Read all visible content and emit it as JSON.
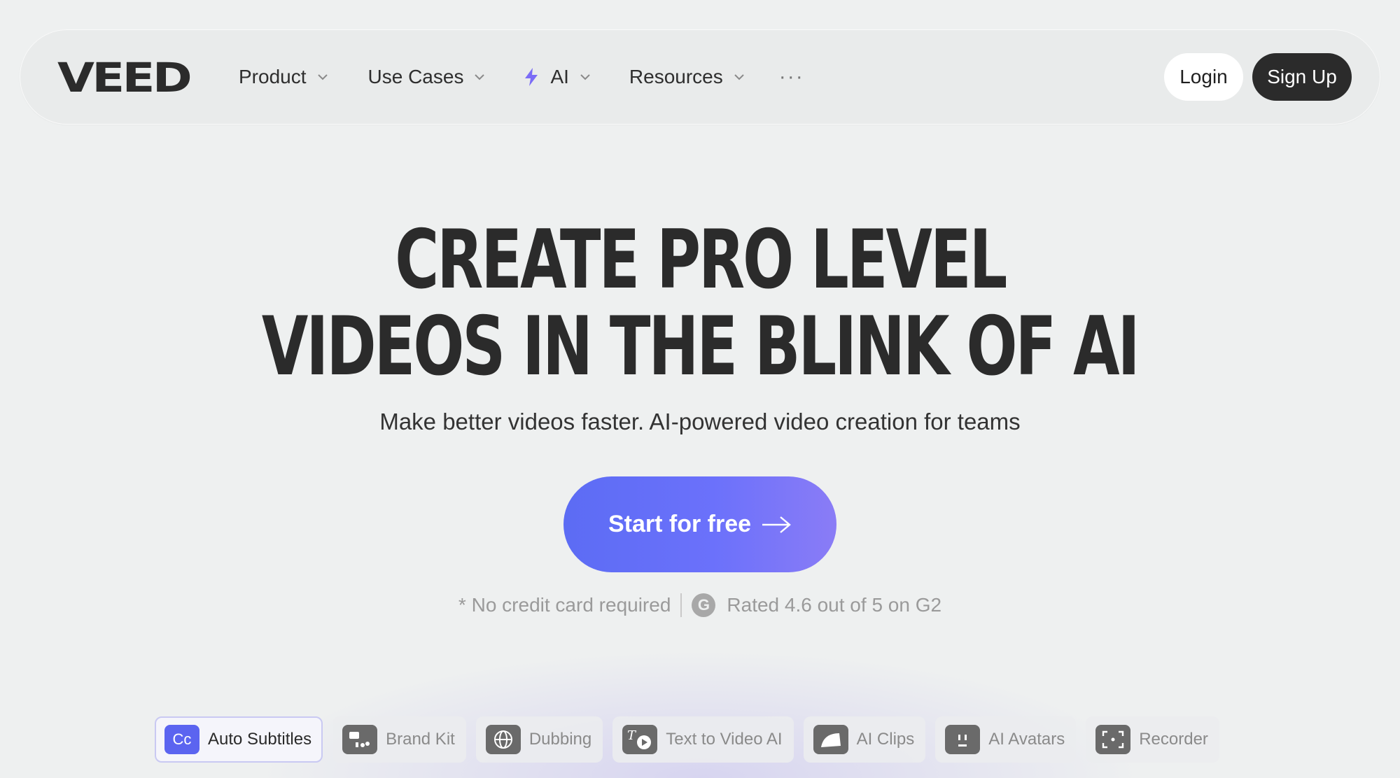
{
  "nav": {
    "logo": "VEED",
    "items": [
      {
        "label": "Product"
      },
      {
        "label": "Use Cases"
      },
      {
        "label": "AI"
      },
      {
        "label": "Resources"
      }
    ],
    "more": "···",
    "login": "Login",
    "signup": "Sign Up"
  },
  "hero": {
    "line1": "CREATE PRO LEVEL",
    "line2": "VIDEOS IN THE BLINK OF AI",
    "subtitle": "Make better videos faster. AI-powered video creation for teams",
    "cta": "Start for free",
    "note": "* No credit card required",
    "rating": "Rated 4.6 out of 5 on G2",
    "g2_badge": "G"
  },
  "tabs": [
    {
      "label": "Auto Subtitles",
      "icon": "cc-icon",
      "icon_text": "Cc",
      "active": true
    },
    {
      "label": "Brand Kit",
      "icon": "brand-kit-icon"
    },
    {
      "label": "Dubbing",
      "icon": "globe-icon"
    },
    {
      "label": "Text to Video AI",
      "icon": "text-to-video-icon"
    },
    {
      "label": "AI Clips",
      "icon": "clips-icon"
    },
    {
      "label": "AI Avatars",
      "icon": "avatar-icon"
    },
    {
      "label": "Recorder",
      "icon": "recorder-icon"
    }
  ],
  "colors": {
    "accent": "#6670f8",
    "dark": "#2b2b2b",
    "background": "#eef0f0",
    "ai_bolt": "#7b6cf6"
  }
}
